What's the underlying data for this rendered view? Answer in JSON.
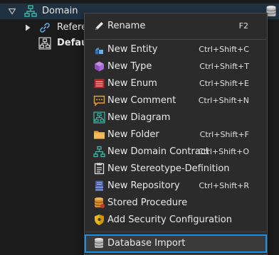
{
  "tree": {
    "root": {
      "label": "Domain",
      "expander": "collapse-triangle-icon",
      "icon": "domain-tree-icon"
    },
    "children": [
      {
        "label": "Refere",
        "icon": "reference-link-icon",
        "bold": false
      },
      {
        "label": "Defau",
        "icon": "diagram-icon",
        "bold": true
      }
    ],
    "right_icon": "database-icon"
  },
  "context_menu": {
    "items": [
      {
        "label": "Rename",
        "shortcut": "F2",
        "icon": "pencil-icon"
      },
      {
        "label": "New Entity",
        "shortcut": "Ctrl+Shift+C",
        "icon": "entity-icon"
      },
      {
        "label": "New Type",
        "shortcut": "Ctrl+Shift+T",
        "icon": "cube-icon"
      },
      {
        "label": "New Enum",
        "shortcut": "Ctrl+Shift+E",
        "icon": "enum-icon"
      },
      {
        "label": "New Comment",
        "shortcut": "Ctrl+Shift+N",
        "icon": "comment-icon"
      },
      {
        "label": "New Diagram",
        "shortcut": "",
        "icon": "diagram-icon"
      },
      {
        "label": "New Folder",
        "shortcut": "Ctrl+Shift+F",
        "icon": "folder-icon"
      },
      {
        "label": "New Domain Contract",
        "shortcut": "Ctrl+Shift+O",
        "icon": "contract-icon"
      },
      {
        "label": "New Stereotype-Definition",
        "shortcut": "",
        "icon": "stereotype-icon"
      },
      {
        "label": "New Repository",
        "shortcut": "Ctrl+Shift+R",
        "icon": "repository-icon"
      },
      {
        "label": "Stored Procedure",
        "shortcut": "",
        "icon": "stored-procedure-icon"
      },
      {
        "label": "Add Security Configuration",
        "shortcut": "",
        "icon": "security-shield-icon"
      },
      {
        "label": "Database Import",
        "shortcut": "",
        "icon": "database-icon",
        "selected": true
      }
    ]
  },
  "colors": {
    "background": "#1b1b1b",
    "menu_background": "#2b2b2b",
    "selection_border": "#1e8fe6",
    "root_row_highlight": "#203142",
    "tree_icon_teal": "#3fb8a8"
  }
}
